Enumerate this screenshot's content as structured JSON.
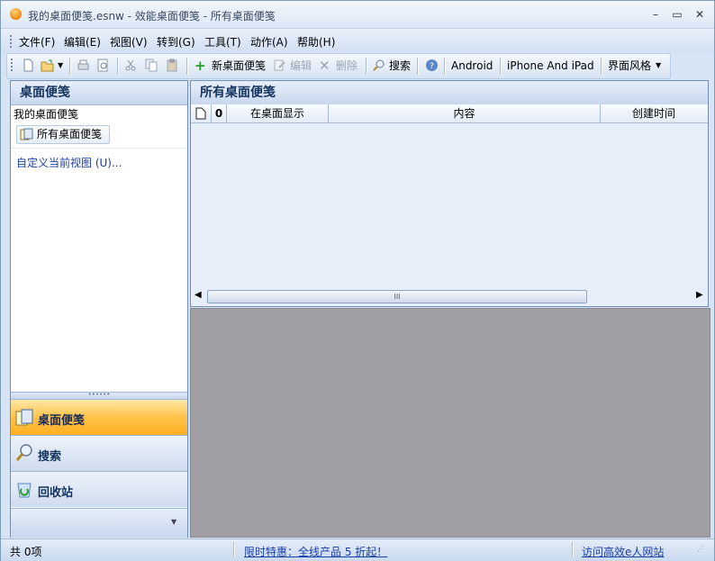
{
  "window": {
    "title": "我的桌面便笺.esnw - 效能桌面便笺 - 所有桌面便笺"
  },
  "menu": [
    "文件(F)",
    "编辑(E)",
    "视图(V)",
    "转到(G)",
    "工具(T)",
    "动作(A)",
    "帮助(H)"
  ],
  "toolbar": {
    "new_note": "新桌面便笺",
    "edit": "编辑",
    "delete": "删除",
    "search": "搜索",
    "android": "Android",
    "iphone": "iPhone And iPad",
    "theme": "界面风格"
  },
  "left_panel": {
    "title": "桌面便笺",
    "group": "我的桌面便笺",
    "selected_item": "所有桌面便笺",
    "custom_view": "自定义当前视图 (U)...",
    "nav": [
      "桌面便笺",
      "搜索",
      "回收站"
    ]
  },
  "main": {
    "title": "所有桌面便笺",
    "columns": [
      "在桌面显示",
      "内容",
      "创建时间"
    ],
    "scroll_thumb": "III"
  },
  "status": {
    "count": "共 0项",
    "promo": "限时特惠：全线产品 5 折起！",
    "visit": "访问高效e人网站"
  },
  "colors": {
    "accent": "#ffc24a",
    "panel_border": "#6f8fb8",
    "preview_bg": "#a09fa3"
  }
}
